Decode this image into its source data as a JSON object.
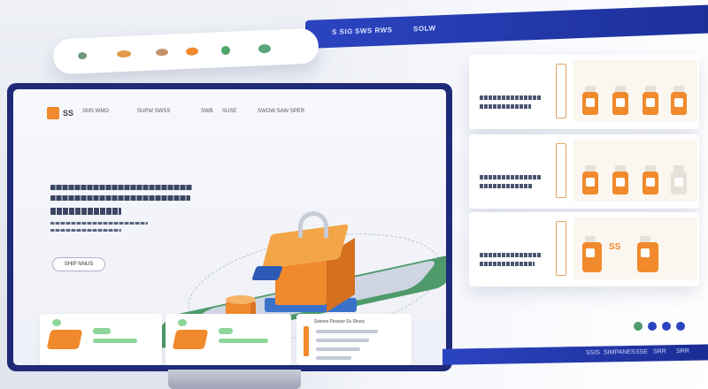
{
  "top_ribbon": {
    "items": [
      "S SIG",
      "SWS RWS",
      "SOLW"
    ]
  },
  "monitor": {
    "logo_text": "SS",
    "nav_left": "SMS WMO",
    "nav_mid": "SUPW SWSS",
    "nav_items": [
      "SWB",
      "SUSE",
      "SWOW SAW SPER"
    ],
    "cta_label": "SHIP NNUS",
    "card3_title": "Ssieow Fhssow Ss Shsss"
  },
  "right_panels": {
    "panel2_label": "SS"
  },
  "bottom_ribbon": {
    "items": [
      "SSIS",
      "SIMPANES",
      "SSE",
      "SRR",
      "SRR"
    ]
  },
  "colors": {
    "accent": "#f08a2c",
    "brand": "#1f2a78",
    "green": "#4e9a6a",
    "ribbon": "#2b44c0"
  }
}
